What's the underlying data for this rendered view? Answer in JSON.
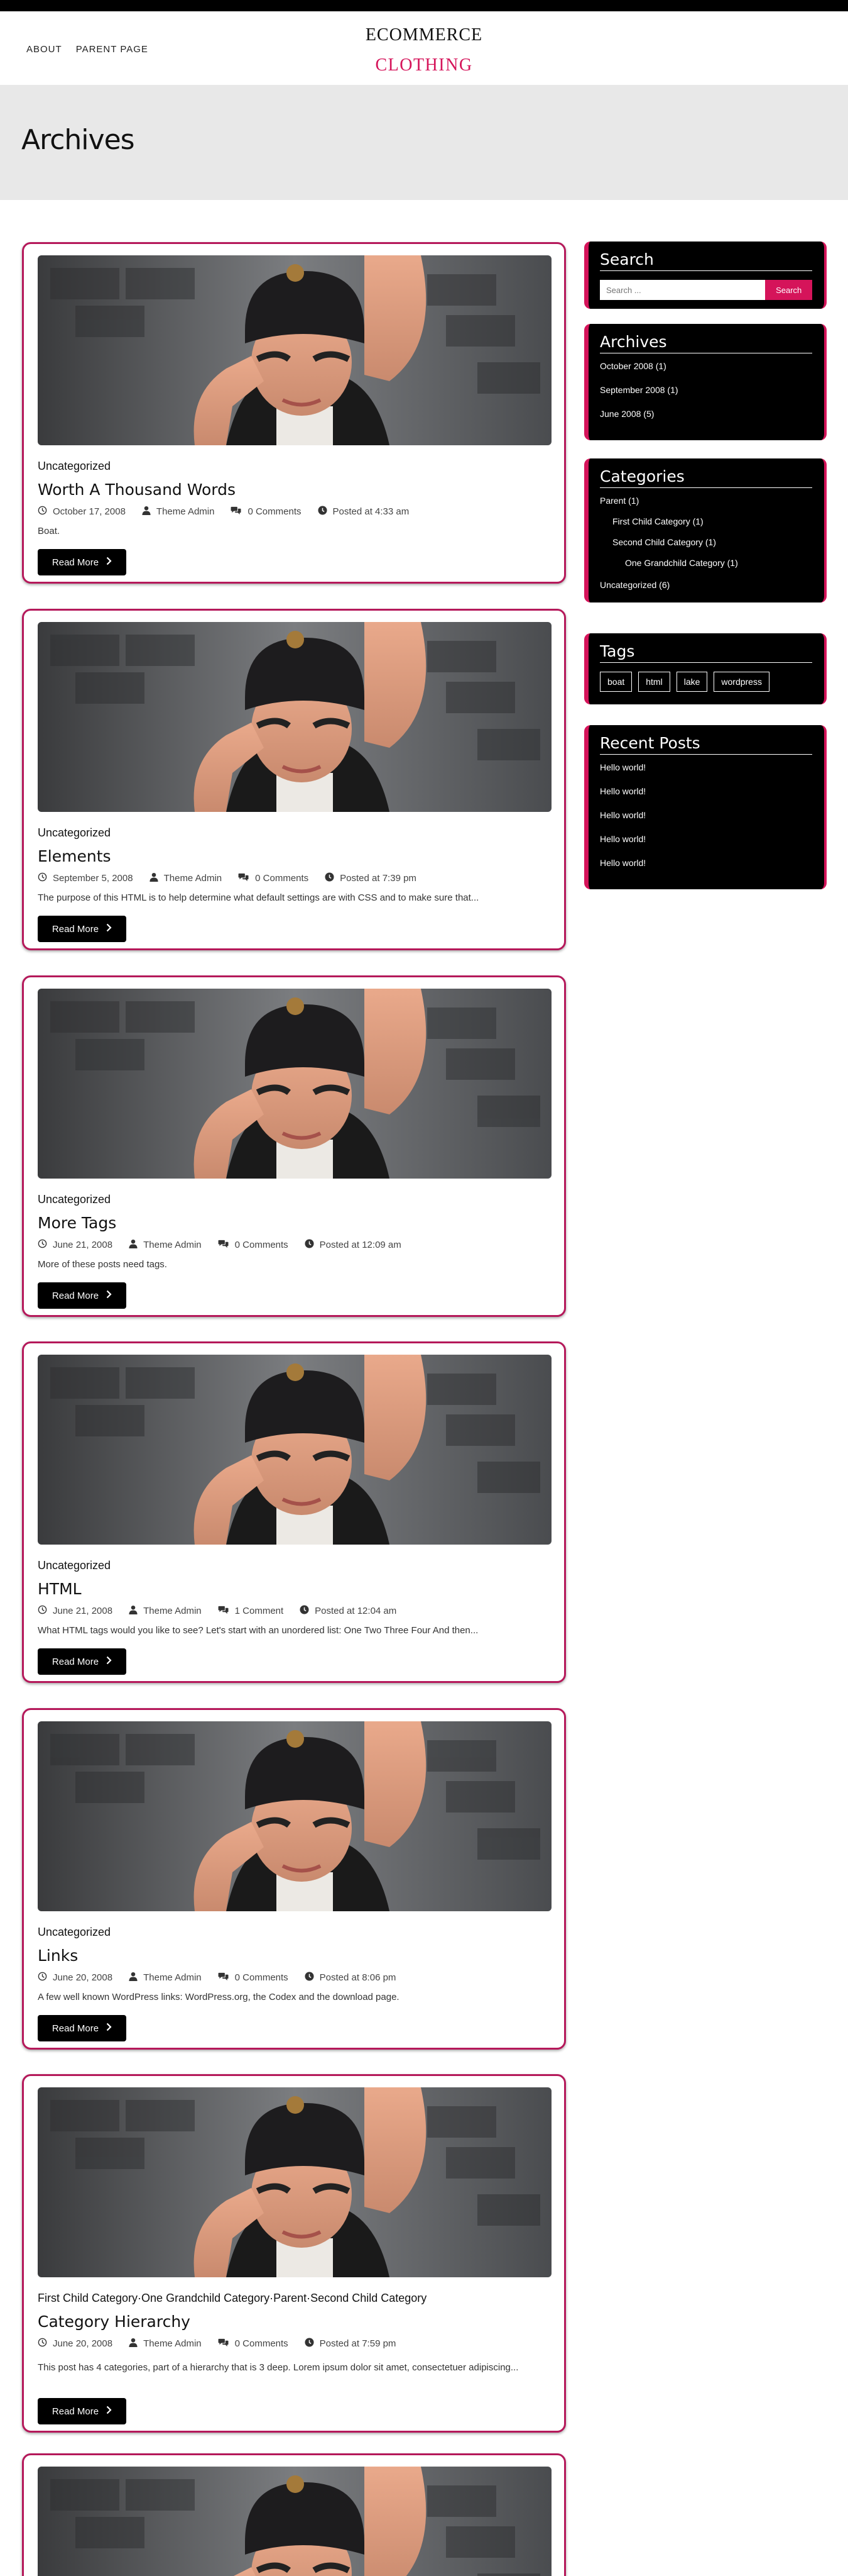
{
  "nav": {
    "items": [
      "ABOUT",
      "PARENT PAGE"
    ]
  },
  "logo": {
    "line1": "ECOMMERCE",
    "line2": "CLOTHING"
  },
  "page": {
    "title": "Archives"
  },
  "read_more_label": "Read More",
  "posts": [
    {
      "category": "Uncategorized",
      "title": "Worth A Thousand Words",
      "date": "October 17, 2008",
      "author": "Theme Admin",
      "comments": "0 Comments",
      "time": "Posted at 4:33 am",
      "excerpt": "Boat."
    },
    {
      "category": "Uncategorized",
      "title": "Elements",
      "date": "September 5, 2008",
      "author": "Theme Admin",
      "comments": "0 Comments",
      "time": "Posted at 7:39 pm",
      "excerpt": "The purpose of this HTML is to help determine what default settings are with CSS and to make sure that..."
    },
    {
      "category": "Uncategorized",
      "title": "More Tags",
      "date": "June 21, 2008",
      "author": "Theme Admin",
      "comments": "0 Comments",
      "time": "Posted at 12:09 am",
      "excerpt": "More of these posts need tags."
    },
    {
      "category": "Uncategorized",
      "title": "HTML",
      "date": "June 21, 2008",
      "author": "Theme Admin",
      "comments": "1 Comment",
      "time": "Posted at 12:04 am",
      "excerpt": "What HTML tags would you like to see? Let's start with an unordered list: One Two Three Four And then..."
    },
    {
      "category": "Uncategorized",
      "title": "Links",
      "date": "June 20, 2008",
      "author": "Theme Admin",
      "comments": "0 Comments",
      "time": "Posted at 8:06 pm",
      "excerpt": "A few well known WordPress links: WordPress.org, the Codex and the download page."
    },
    {
      "category": "First Child Category, One Grandchild Category, Parent, Second Child Category",
      "title": "Category Hierarchy",
      "date": "June 20, 2008",
      "author": "Theme Admin",
      "comments": "0 Comments",
      "time": "Posted at 7:59 pm",
      "excerpt": "This post has 4 categories, part of a hierarchy that is 3 deep. Lorem ipsum dolor sit amet, consectetuer adipiscing..."
    }
  ],
  "sidebar": {
    "search": {
      "title": "Search",
      "placeholder": "Search ...",
      "button": "Search"
    },
    "archives": {
      "title": "Archives",
      "items": [
        "October 2008 (1)",
        "September 2008 (1)",
        "June 2008 (5)"
      ]
    },
    "categories": {
      "title": "Categories",
      "items": [
        "Parent (1)",
        "First Child Category (1)",
        "Second Child Category (1)",
        "One Grandchild Category (1)",
        "Uncategorized (6)"
      ]
    },
    "tags": {
      "title": "Tags",
      "items": [
        "boat",
        "html",
        "lake",
        "wordpress"
      ]
    },
    "recent": {
      "title": "Recent Posts",
      "items": [
        "Hello world!",
        "Hello world!",
        "Hello world!",
        "Hello world!",
        "Hello world!"
      ]
    }
  },
  "colors": {
    "accent": "#d5145a",
    "border": "#b5185a",
    "banner": "#e8e8e8",
    "widget_bg": "#000000"
  }
}
